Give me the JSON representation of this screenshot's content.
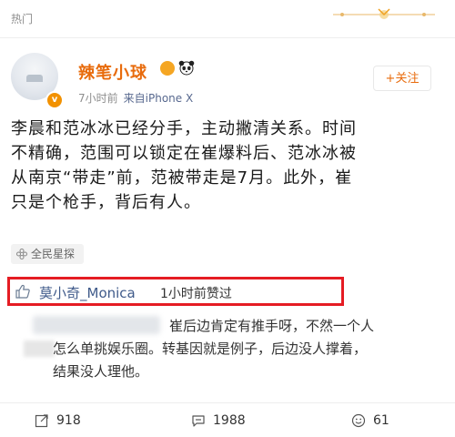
{
  "top_bar": {
    "label": "热门"
  },
  "post": {
    "username": "辣笔小球",
    "time": "7小时前",
    "source": "来自iPhone X",
    "follow_label": "+关注",
    "lines": [
      "李晨和范冰冰已经分手，主动撇清关系。时间",
      "不精确，范围可以锁定在崔爆料后、范冰冰被",
      "从南京“带走”前，范被带走是7月。此外，崔",
      "只是个枪手，背后有人。"
    ],
    "tag": "全民星探"
  },
  "like_row": {
    "name": "莫小奇_Monica",
    "time_text": "1小时前赞过"
  },
  "comment": {
    "lines": [
      "崔后边肯定有推手呀，不然一个人",
      "怎么单挑娱乐圈。转基因就是例子，后边没人撑着，",
      "结果没人理他。"
    ]
  },
  "actions": {
    "repost_count": "918",
    "comment_count": "1988",
    "like_count": "61"
  },
  "colors": {
    "username": "#e86b0c",
    "highlight_box": "#e51c23",
    "link_name": "#3f5a8a",
    "meta": "#8e8e8e"
  }
}
